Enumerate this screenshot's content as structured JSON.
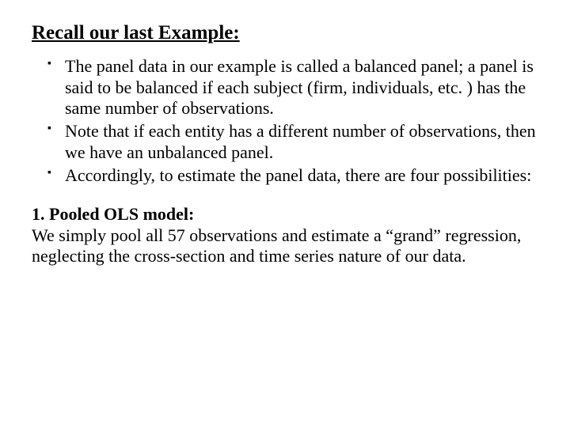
{
  "heading": "Recall our last Example:",
  "bullets": [
    "The panel data in our example is called a balanced panel; a panel is said to be balanced if each subject (firm, individuals, etc. ) has the same number of observations.",
    "Note that if each entity has a different number of observations, then we have an unbalanced panel.",
    "Accordingly, to estimate the panel data, there are four possibilities:"
  ],
  "section": {
    "title": "1. Pooled OLS model:",
    "body": "We simply pool all 57 observations and estimate a “grand” regression, neglecting the cross-section and time series nature of our data."
  }
}
